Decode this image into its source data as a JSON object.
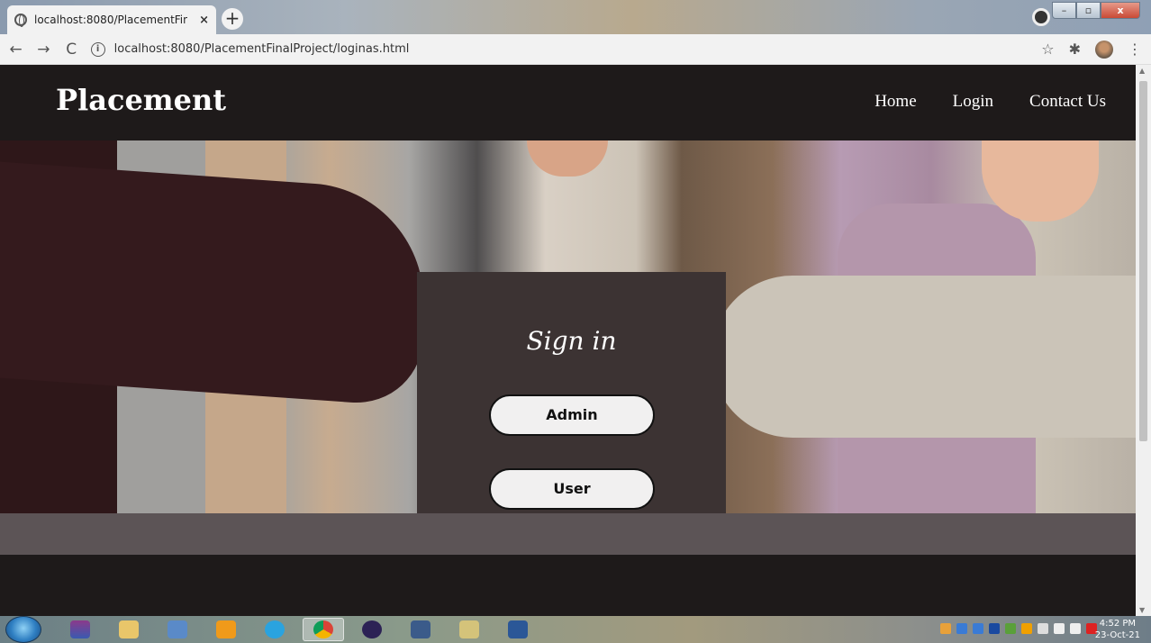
{
  "browser": {
    "tab_title": "localhost:8080/PlacementFinalPr",
    "tab_close": "×",
    "new_tab": "+",
    "url": "localhost:8080/PlacementFinalProject/loginas.html",
    "info_icon": "i",
    "back": "←",
    "forward": "→",
    "reload": "C",
    "star": "☆",
    "extensions": "✱",
    "menu": "⋮",
    "win_min": "–",
    "win_max": "▫",
    "win_close": "x"
  },
  "header": {
    "brand": "Placement",
    "nav": [
      "Home",
      "Login",
      "Contact Us"
    ]
  },
  "signin": {
    "title": "Sign in",
    "admin_label": "Admin",
    "user_label": "User"
  },
  "taskbar": {
    "time": "4:52 PM",
    "date": "23-Oct-21"
  },
  "colors": {
    "header_bg": "#1e1a1a",
    "card_bg": "#3c3333",
    "band_bg": "#5c5456",
    "button_bg": "#f1f0f0"
  }
}
